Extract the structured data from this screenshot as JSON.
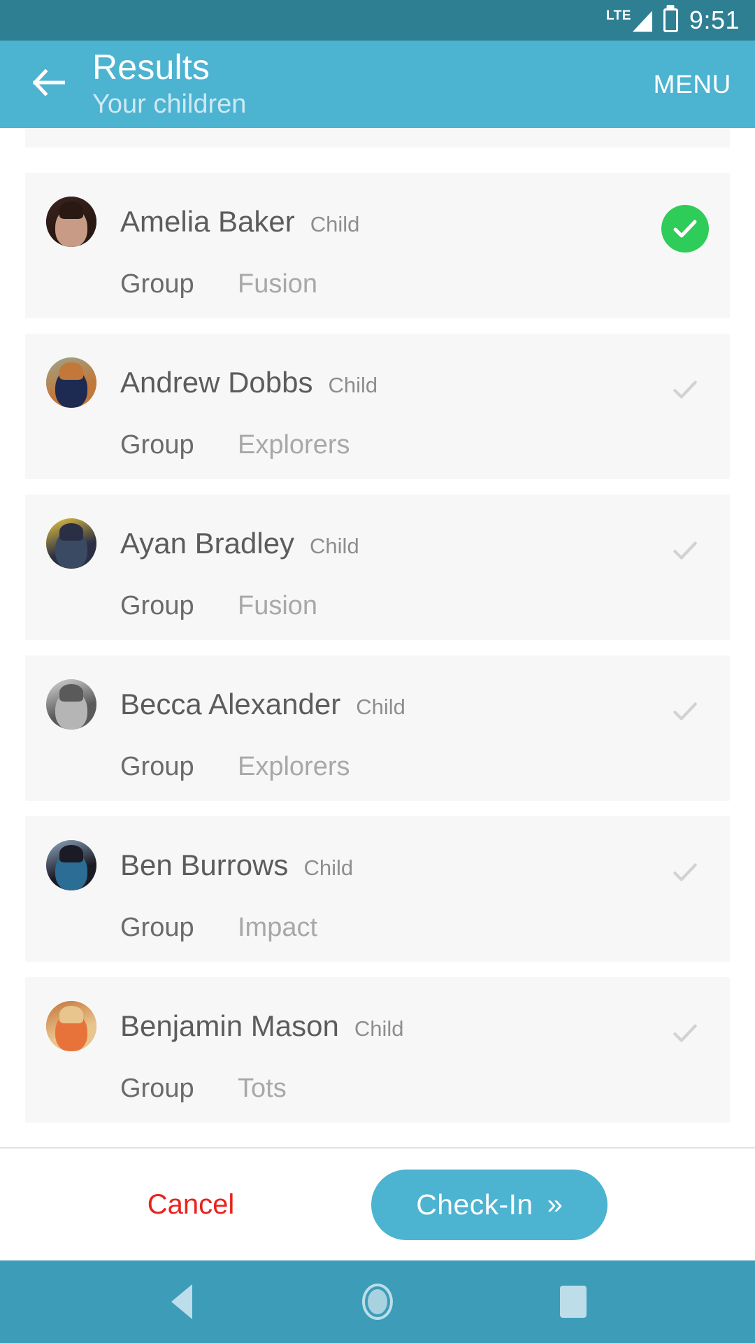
{
  "status_bar": {
    "network": "LTE",
    "time": "9:51",
    "battery_icon": "battery-charging-icon",
    "signal_icon": "signal-bars-icon"
  },
  "app_bar": {
    "back_icon": "back-arrow-icon",
    "title": "Results",
    "subtitle": "Your children",
    "menu_label": "MENU"
  },
  "list": {
    "group_label": "Group",
    "items": [
      {
        "name": "Amelia Baker",
        "role": "Child",
        "group": "Fusion",
        "selected": true,
        "avatar": {
          "bg": "#3a2420",
          "hair": "#2a1813",
          "skin": "#c79b86"
        }
      },
      {
        "name": "Andrew Dobbs",
        "role": "Child",
        "group": "Explorers",
        "selected": false,
        "avatar": {
          "bg": "#9ba58c",
          "hair": "#c2783a",
          "skin": "#1d2a52"
        }
      },
      {
        "name": "Ayan Bradley",
        "role": "Child",
        "group": "Fusion",
        "selected": false,
        "avatar": {
          "bg": "#e8c73f",
          "hair": "#2b2f45",
          "skin": "#3b4a63"
        }
      },
      {
        "name": "Becca Alexander",
        "role": "Child",
        "group": "Explorers",
        "selected": false,
        "avatar": {
          "bg": "#d9d9d9",
          "hair": "#5a5a5a",
          "skin": "#b5b5b5"
        }
      },
      {
        "name": "Ben Burrows",
        "role": "Child",
        "group": "Impact",
        "selected": false,
        "avatar": {
          "bg": "#8fa9c4",
          "hair": "#1b1b25",
          "skin": "#2b6d95"
        }
      },
      {
        "name": "Benjamin Mason",
        "role": "Child",
        "group": "Tots",
        "selected": false,
        "avatar": {
          "bg": "#c4743a",
          "hair": "#e8c58d",
          "skin": "#e8733a"
        }
      }
    ]
  },
  "actions": {
    "cancel_label": "Cancel",
    "checkin_label": "Check-In",
    "checkin_chevron": "»"
  },
  "nav_bar": {
    "back_icon": "nav-back-icon",
    "home_icon": "nav-home-icon",
    "recents_icon": "nav-recents-icon"
  },
  "colors": {
    "status_bar": "#2f7f93",
    "app_bar": "#4cb3d1",
    "accent": "#4cb3d1",
    "selected_check": "#2ecc58",
    "cancel_text": "#e8231f",
    "card_bg": "#f7f7f7"
  }
}
